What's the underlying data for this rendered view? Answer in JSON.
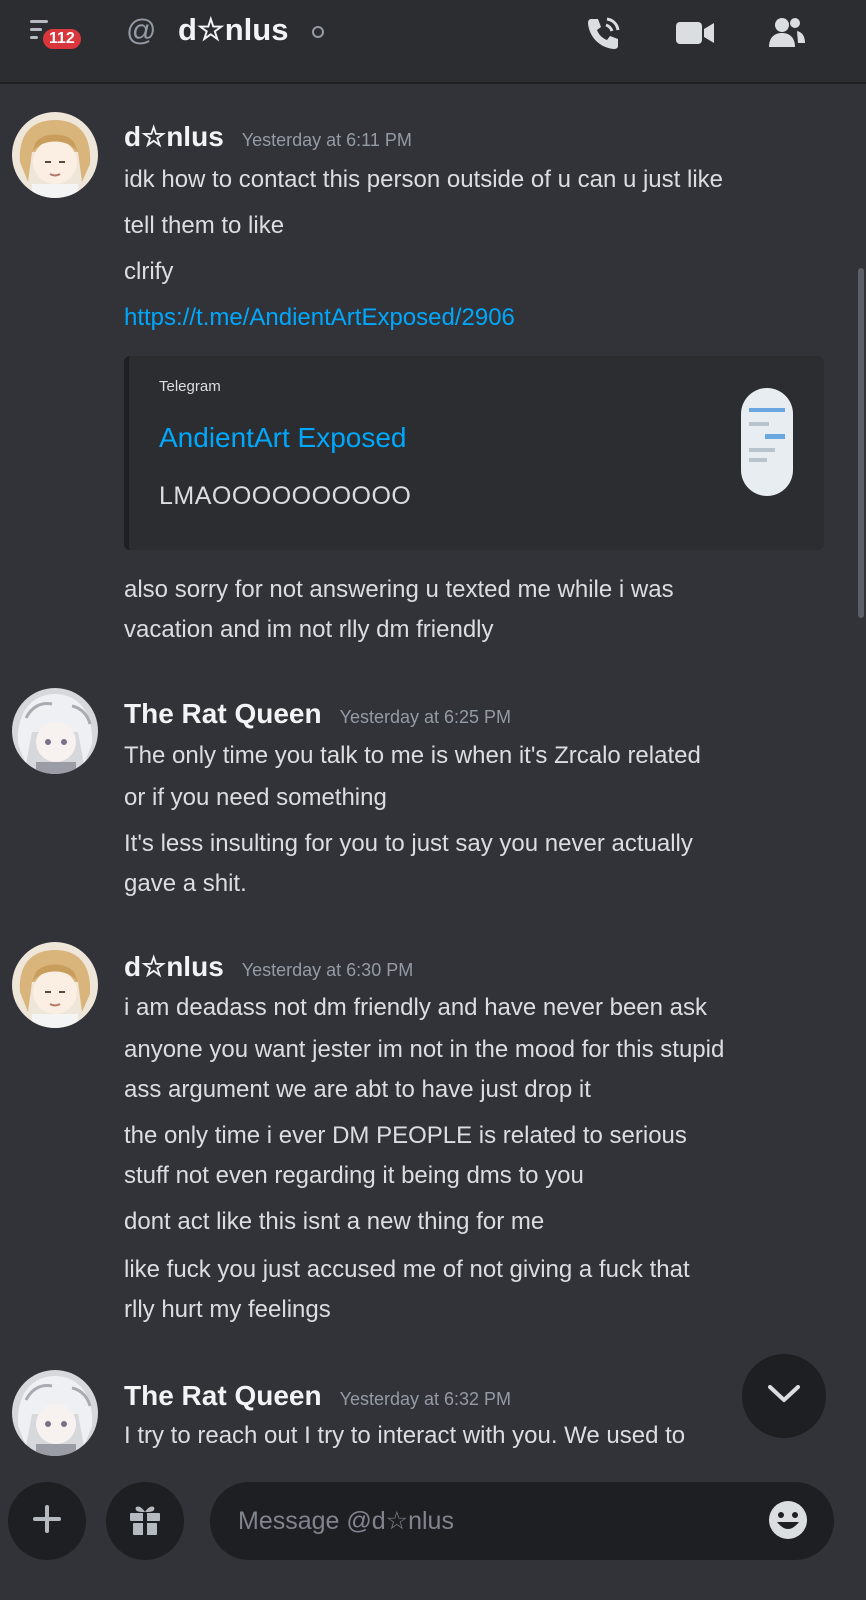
{
  "header": {
    "notification_count": "112",
    "at_symbol": "@",
    "dm_name": "d☆nlus",
    "icons": [
      "menu-icon",
      "at-icon",
      "phone-call-icon",
      "video-call-icon",
      "member-list-icon"
    ]
  },
  "messages": [
    {
      "author": "d☆nlus",
      "timestamp": "Yesterday at 6:11 PM",
      "lines": [
        "idk how to contact this person outside of u can u just like",
        "tell them to like",
        "clrify"
      ],
      "link": "https://t.me/AndientArtExposed/2906",
      "embed": {
        "provider": "Telegram",
        "title": "AndientArt Exposed",
        "description": "LMAOOOOOOOOOO"
      },
      "after_embed": [
        "also sorry for not answering u texted me while i was",
        "vacation and im not rlly dm friendly"
      ]
    },
    {
      "author": "The Rat Queen",
      "timestamp": "Yesterday at 6:25 PM",
      "lines": [
        "The only time you talk to me is when it's Zrcalo related",
        "or if you need something",
        "It's less insulting for you to just say you never actually",
        "gave a shit."
      ]
    },
    {
      "author": "d☆nlus",
      "timestamp": "Yesterday at 6:30 PM",
      "lines": [
        "i am deadass not dm friendly and have never been ask",
        "anyone you want jester im not in the mood for this stupid",
        "ass argument we are abt to have just drop it",
        "the only time i ever DM PEOPLE is related to serious",
        "stuff not even regarding it being dms to you",
        "dont act like this isnt a new thing for me",
        "like fuck you just accused me of not giving a fuck that",
        "rlly hurt my feelings"
      ]
    },
    {
      "author": "The Rat Queen",
      "timestamp": "Yesterday at 6:32 PM",
      "lines": [
        "I try to reach out I try to interact with you. We used to"
      ]
    }
  ],
  "composer": {
    "placeholder": "Message @d☆nlus"
  },
  "colors": {
    "background": "#313338",
    "header": "#2b2d31",
    "link": "#00a8fc",
    "badge": "#da373c"
  }
}
